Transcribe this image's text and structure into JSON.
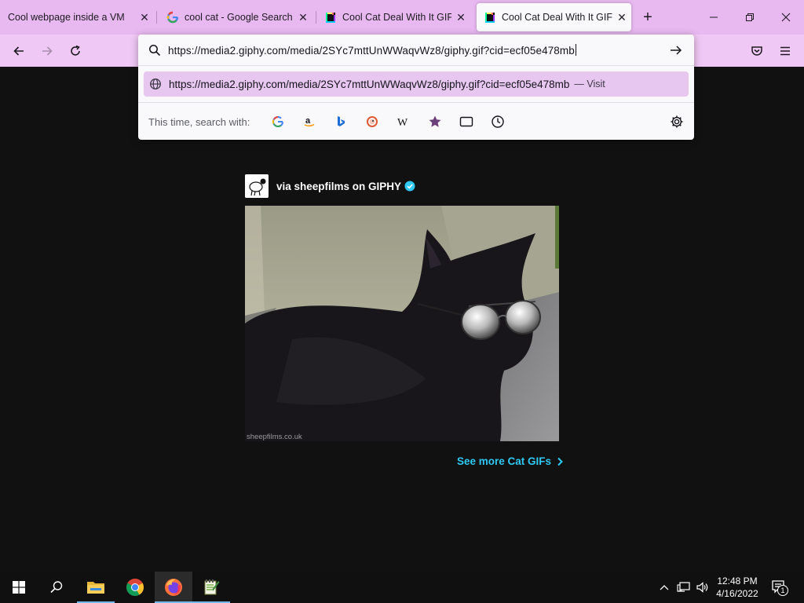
{
  "tabs": [
    {
      "title": "Cool webpage inside a VM",
      "active": false
    },
    {
      "title": "cool cat - Google Search",
      "active": false
    },
    {
      "title": "Cool Cat Deal With It GIF by",
      "active": false
    },
    {
      "title": "Cool Cat Deal With It GIF by",
      "active": true
    }
  ],
  "urlbar": {
    "value": "https://media2.giphy.com/media/2SYc7mttUnWWaqvWz8/giphy.gif?cid=ecf05e478mb",
    "suggestion_url": "https://media2.giphy.com/media/2SYc7mttUnWWaqvWz8/giphy.gif?cid=ecf05e478mb",
    "suggestion_action": "— Visit",
    "search_with_label": "This time, search with:",
    "engines": [
      "google-icon",
      "amazon-icon",
      "bing-icon",
      "duckduckgo-icon",
      "wikipedia-icon",
      "bookmarks-icon",
      "tabs-icon",
      "history-icon"
    ]
  },
  "page": {
    "attribution": "via sheepfilms on GIPHY",
    "watermark": "sheepfilms.co.uk",
    "see_more": "See more Cat GIFs"
  },
  "taskbar": {
    "apps": [
      "file-explorer-icon",
      "chrome-icon",
      "firefox-icon",
      "notepad-plus-icon"
    ],
    "time": "12:48 PM",
    "date": "4/16/2022",
    "notification_count": "1"
  },
  "colors": {
    "tabstrip": "#e8b8f0",
    "navbar": "#f0c8f5",
    "page_bg": "#111112",
    "link": "#2ec9f5"
  }
}
